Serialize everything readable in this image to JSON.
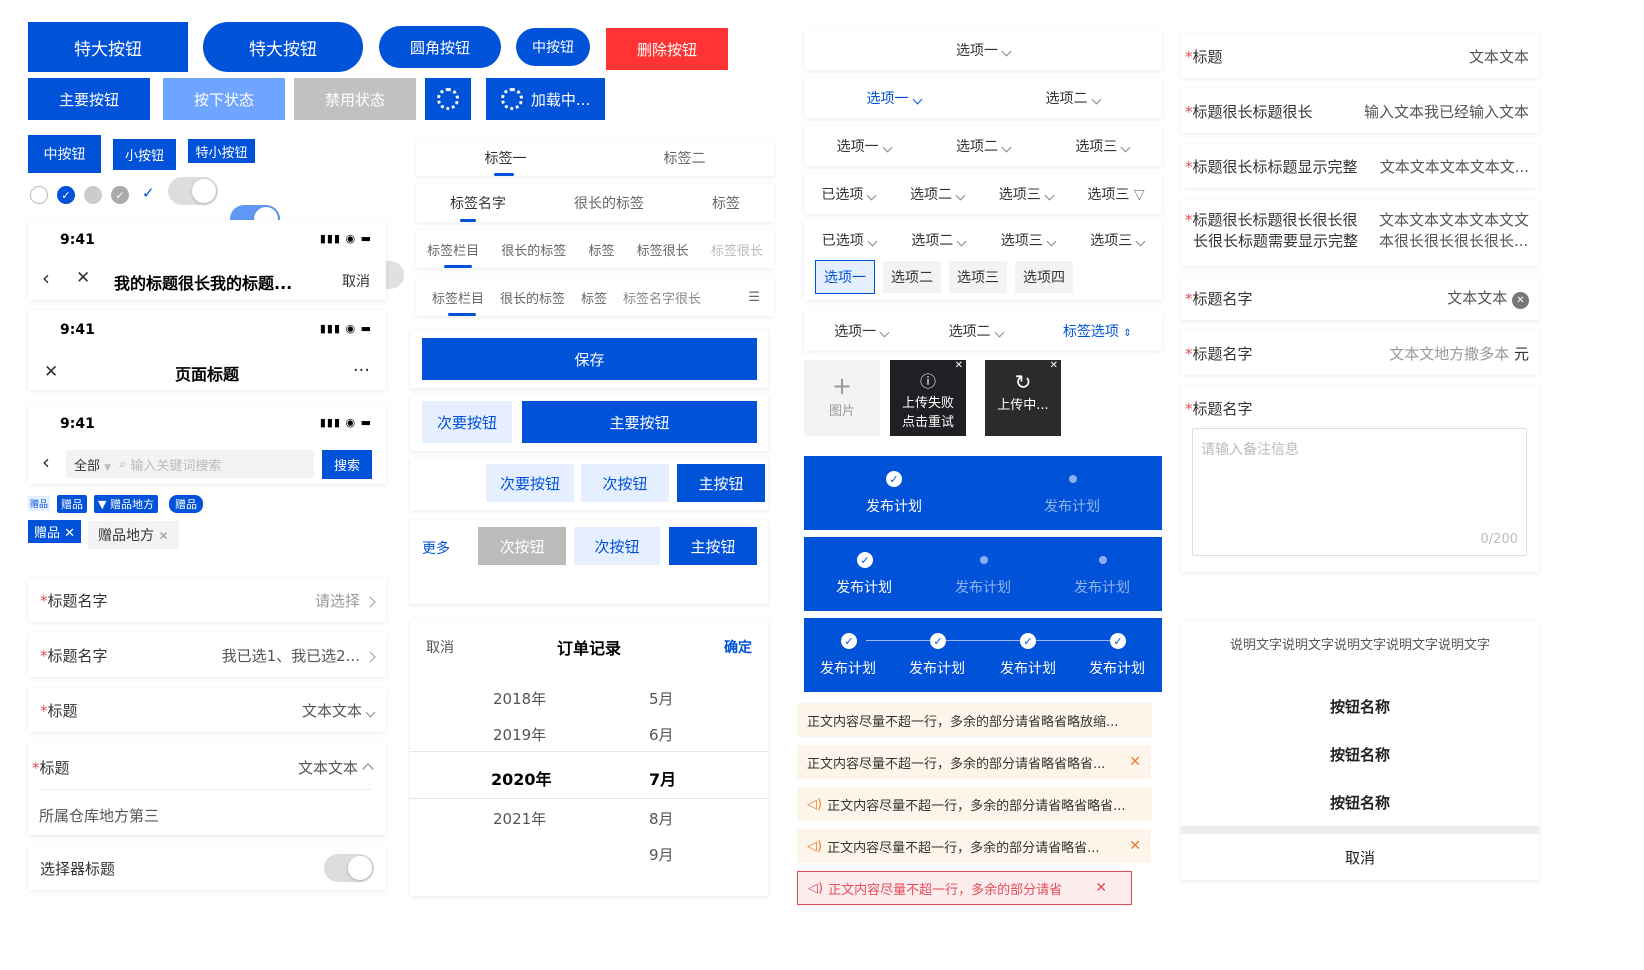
{
  "buttons": {
    "xl1": "特大按钮",
    "xl2": "特大按钮",
    "round": "圆角按钮",
    "mid_round": "中按钮",
    "delete": "删除按钮",
    "primary": "主要按钮",
    "pressed": "按下状态",
    "disabled": "禁用状态",
    "loading": "加载中...",
    "mid": "中按钮",
    "small": "小按钮",
    "xsmall": "特小按钮"
  },
  "navbars": {
    "time": "9:41",
    "nav1_title": "我的标题很长我的标题...",
    "nav1_cancel": "取消",
    "nav2_title": "页面标题",
    "nav3_scope": "全部",
    "nav3_placeholder": "输入关键词搜索",
    "nav3_search": "搜索"
  },
  "tags": {
    "t1": "赠品",
    "t2": "赠品",
    "t3": "赠品地方",
    "t4": "赠品",
    "t5": "赠品",
    "t6": "赠品地方"
  },
  "form_left": {
    "r1_label": "标题名字",
    "r1_value": "请选择",
    "r2_label": "标题名字",
    "r2_value": "我已选1、我已选2...",
    "r3_label": "标题",
    "r3_value": "文本文本",
    "r4_label": "标题",
    "r4_value": "文本文本",
    "r4_option": "所属仓库地方第三",
    "r5_label": "选择器标题"
  },
  "tabs": {
    "a1": "标签一",
    "a2": "标签二",
    "b1": "标签名字",
    "b2": "很长的标签",
    "b3": "标签",
    "c1": "标签栏目",
    "c2": "很长的标签",
    "c3": "标签",
    "c4": "标签很长",
    "c5": "标签很长",
    "d1": "标签栏目",
    "d2": "很长的标签",
    "d3": "标签",
    "d4": "标签名字很长"
  },
  "actions": {
    "save": "保存",
    "sec1": "次要按钮",
    "pri1": "主要按钮",
    "sec2": "次要按钮",
    "sec3": "次按钮",
    "pri2": "主按钮",
    "more": "更多",
    "sec4": "次按钮",
    "sec5": "次按钮",
    "pri3": "主按钮"
  },
  "picker": {
    "cancel": "取消",
    "title": "订单记录",
    "confirm": "确定",
    "years": [
      "2018年",
      "2019年",
      "2020年",
      "2021年"
    ],
    "months": [
      "5月",
      "6月",
      "7月",
      "8月",
      "9月"
    ]
  },
  "selects": {
    "s1": "选项一",
    "s2a": "选项一",
    "s2b": "选项二",
    "s3a": "选项一",
    "s3b": "选项二",
    "s3c": "选项三",
    "s4a": "已选项",
    "s4b": "选项二",
    "s4c": "选项三",
    "s4d": "选项三",
    "s5a": "已选项",
    "s5b": "选项二",
    "s5c": "选项三",
    "s5d": "选项三",
    "o1": "选项一",
    "o2": "选项二",
    "o3": "选项三",
    "o4": "选项四",
    "s6a": "选项一",
    "s6b": "选项二",
    "s6c": "标签选项"
  },
  "upload": {
    "add": "图片",
    "fail1": "上传失败",
    "fail2": "点击重试",
    "loading": "上传中..."
  },
  "steps": {
    "label": "发布计划"
  },
  "notices": {
    "n1": "正文内容尽量不超一行，多余的部分请省略省略放缩...",
    "n2": "正文内容尽量不超一行，多余的部分请省略省略省...",
    "n3": "正文内容尽量不超一行，多余的部分请省略省略省...",
    "n4": "正文内容尽量不超一行，多余的部分请省略省...",
    "n5": "正文内容尽量不超一行，多余的部分请省"
  },
  "form_right": {
    "r1_label": "标题",
    "r1_value": "文本文本",
    "r2_label": "标题很长标题很长",
    "r2_value": "输入文本我已经输入文本",
    "r3_label": "标题很长标标题显示完整",
    "r3_value": "文本文本文本文本文...",
    "r4_label1": "标题很长标题很长很长很",
    "r4_label2": "长很长标题需要显示完整",
    "r4_value1": "文本文本文本文本文文",
    "r4_value2": "本很长很长很长很长...",
    "r5_label": "标题名字",
    "r5_value": "文本文本",
    "r6_label": "标题名字",
    "r6_value": "文本文地方撒多本",
    "r6_unit": "元",
    "r7_label": "标题名字",
    "r7_placeholder": "请输入备注信息",
    "r7_count": "0/200"
  },
  "action_sheet": {
    "desc": "说明文字说明文字说明文字说明文字说明文字",
    "b1": "按钮名称",
    "b2": "按钮名称",
    "b3": "按钮名称",
    "cancel": "取消"
  },
  "colors": {
    "primary": "#0052d9",
    "danger": "#e34d59",
    "warning": "#ed7b2f"
  }
}
